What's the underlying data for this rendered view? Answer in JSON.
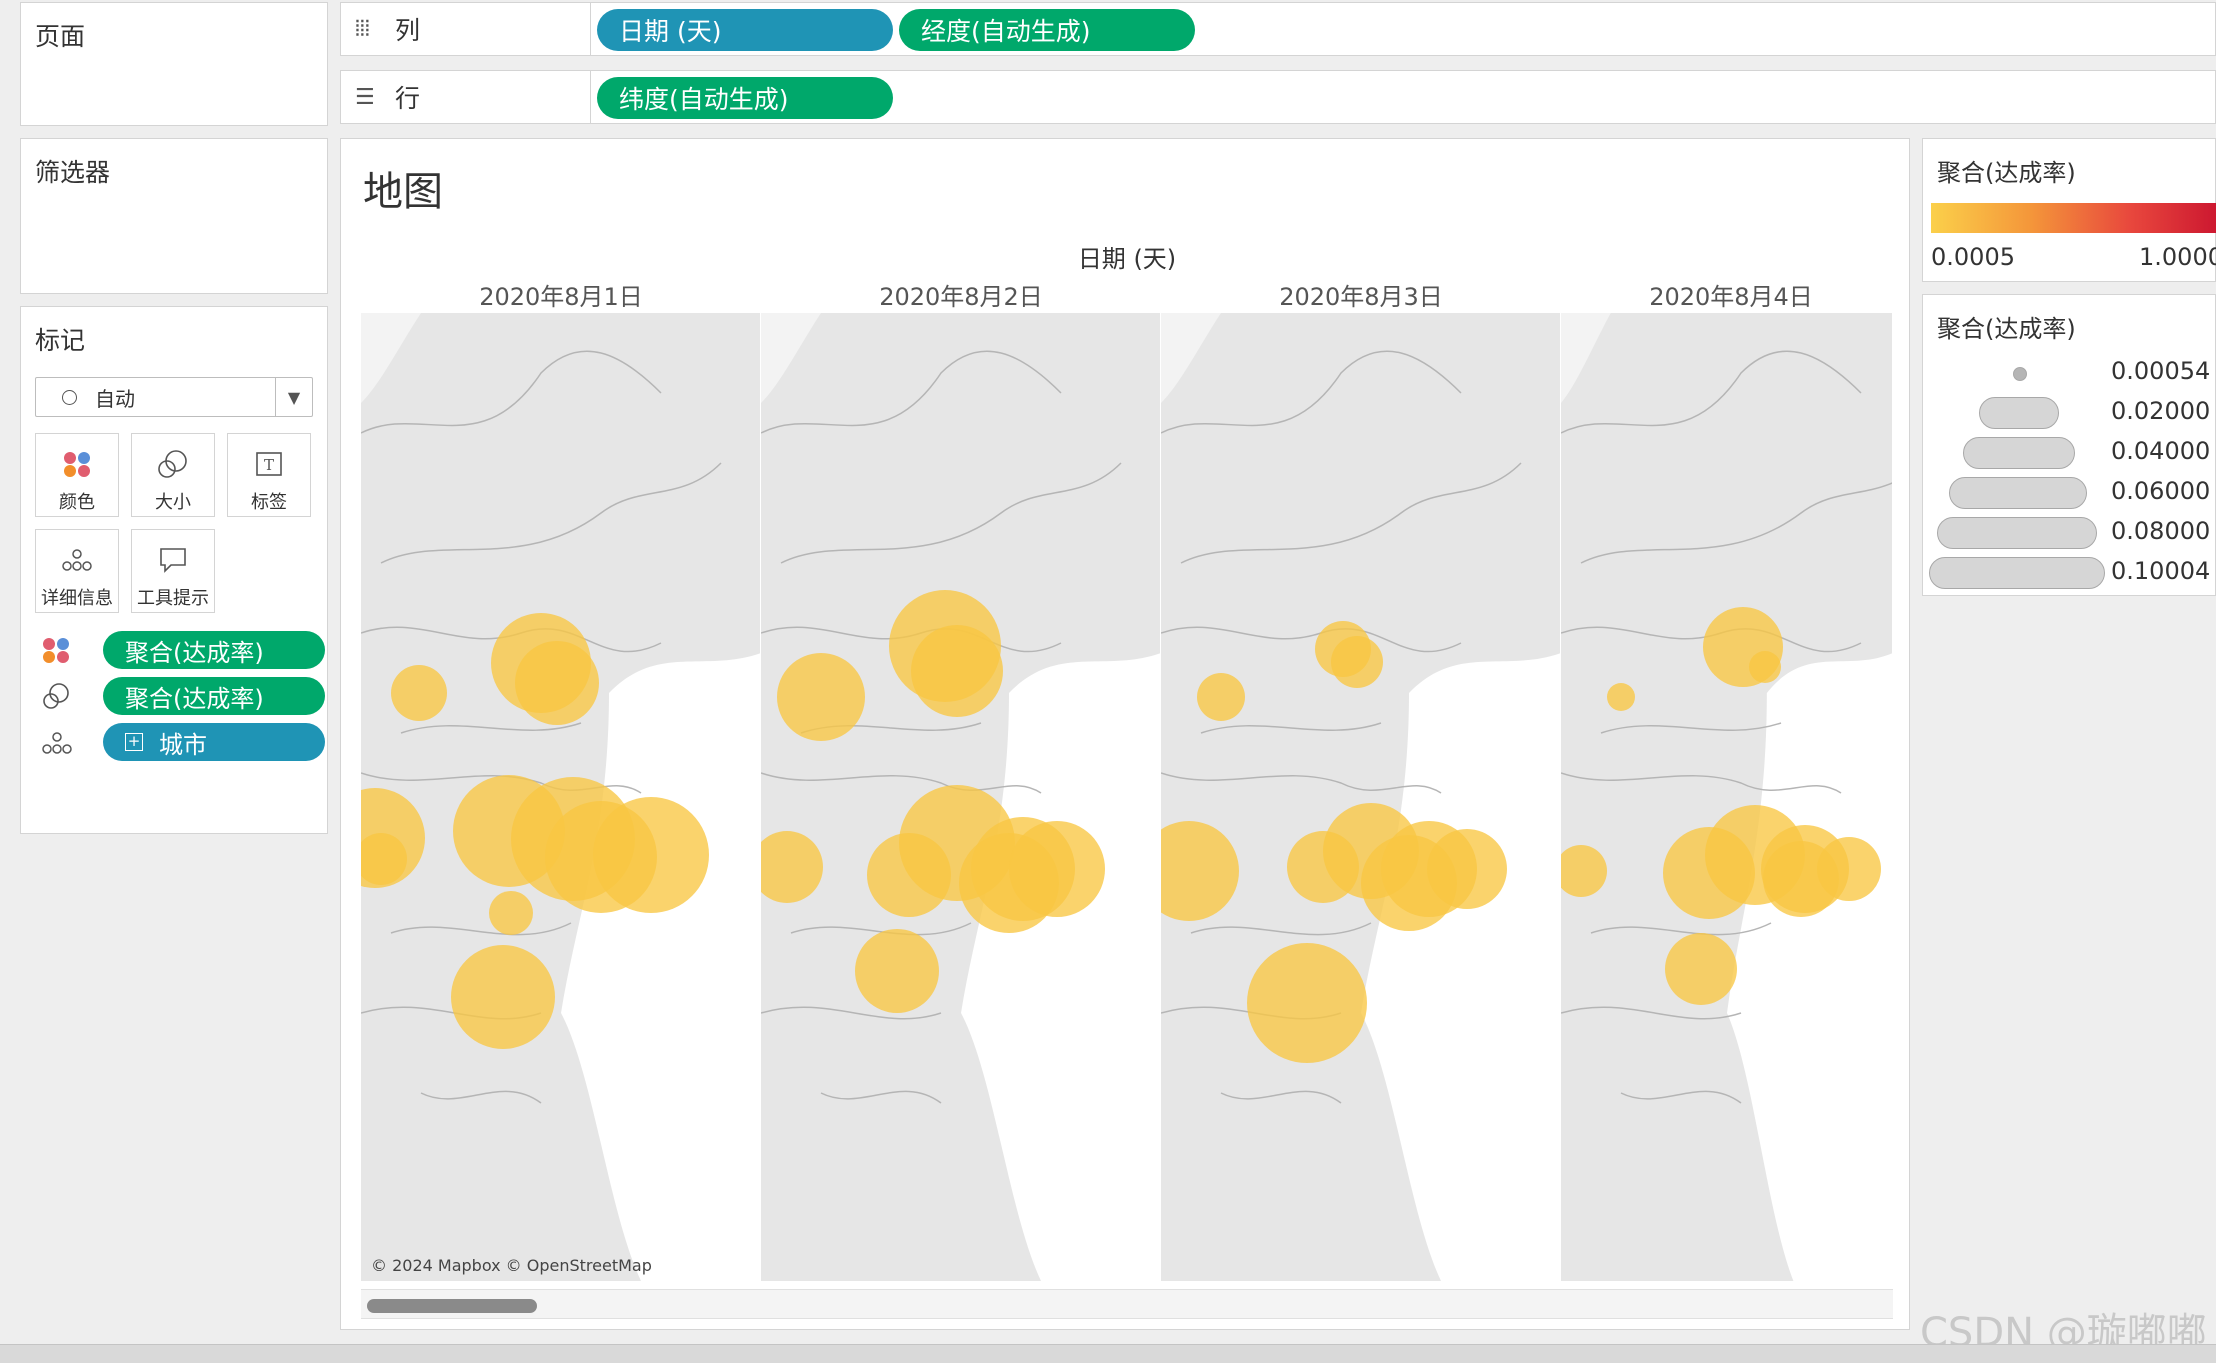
{
  "pages": {
    "title": "页面"
  },
  "columns_shelf": {
    "label": "列",
    "icon": "columns-icon",
    "pills": [
      "日期 (天)",
      "经度(自动生成)"
    ]
  },
  "rows_shelf": {
    "label": "行",
    "icon": "rows-icon",
    "pills": [
      "纬度(自动生成)"
    ]
  },
  "filters": {
    "title": "筛选器"
  },
  "marks": {
    "title": "标记",
    "mark_type": "自动",
    "buttons": {
      "color": "颜色",
      "size": "大小",
      "label": "标签",
      "detail": "详细信息",
      "tooltip": "工具提示"
    },
    "fields": [
      {
        "icon": "color-icon",
        "label": "聚合(达成率)",
        "color": "#00a86b"
      },
      {
        "icon": "size-icon",
        "label": "聚合(达成率)",
        "color": "#00a86b"
      },
      {
        "icon": "detail-icon",
        "label": "城市",
        "color": "#1f94b5"
      }
    ]
  },
  "viz": {
    "title": "地图",
    "column_header": "日期 (天)",
    "days": [
      "2020年8月1日",
      "2020年8月2日",
      "2020年8月3日",
      "2020年8月4日"
    ],
    "attribution": "© 2024 Mapbox © OpenStreetMap",
    "marker_color": "#f9c642"
  },
  "color_legend": {
    "title": "聚合(达成率)",
    "min": "0.0005",
    "max": "1.0000",
    "colors": [
      "#fbd04a",
      "#f4963a",
      "#e8473d",
      "#c8102e"
    ]
  },
  "size_legend": {
    "title": "聚合(达成率)",
    "values": [
      "0.00054",
      "0.02000",
      "0.04000",
      "0.06000",
      "0.08000",
      "0.10004"
    ]
  },
  "watermark": "CSDN @璇嘟嘟"
}
